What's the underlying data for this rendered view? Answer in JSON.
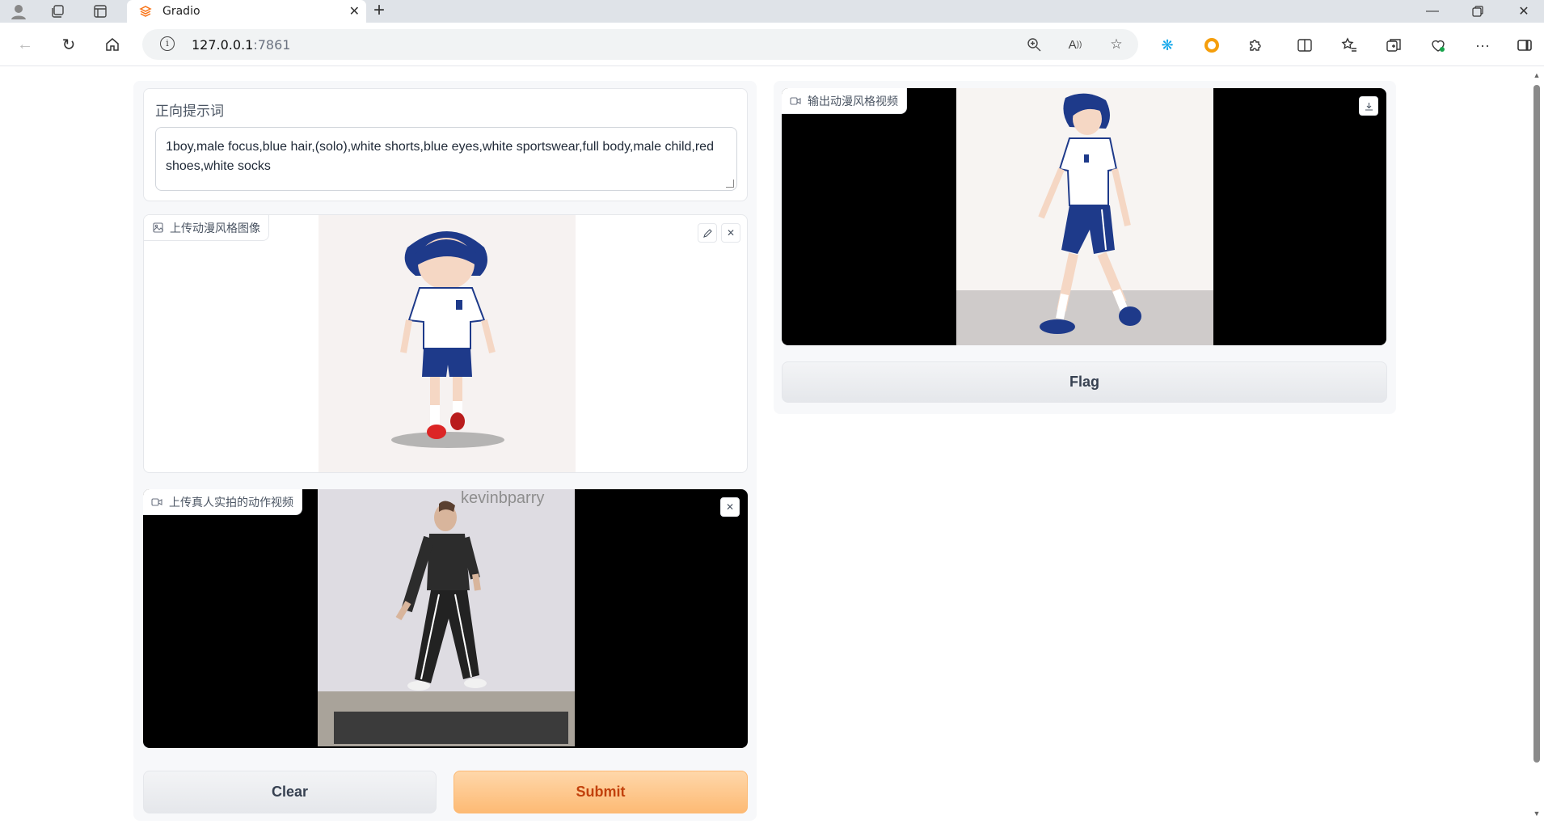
{
  "browser": {
    "tab_title": "Gradio",
    "url_host": "127.0.0.1",
    "url_port": ":7861"
  },
  "prompt": {
    "label": "正向提示词",
    "value": "1boy,male focus,blue hair,(solo),white shorts,blue eyes,white sportswear,full body,male child,red shoes,white socks"
  },
  "image_input": {
    "label": "上传动漫风格图像"
  },
  "video_input": {
    "label": "上传真人实拍的动作视频",
    "watermark": "kevinbparry"
  },
  "video_output": {
    "label": "输出动漫风格视频"
  },
  "buttons": {
    "clear": "Clear",
    "submit": "Submit",
    "flag": "Flag"
  },
  "colors": {
    "primary": "#fdba74",
    "primary_text": "#c2410c",
    "panel_bg": "#f7f8fa"
  }
}
